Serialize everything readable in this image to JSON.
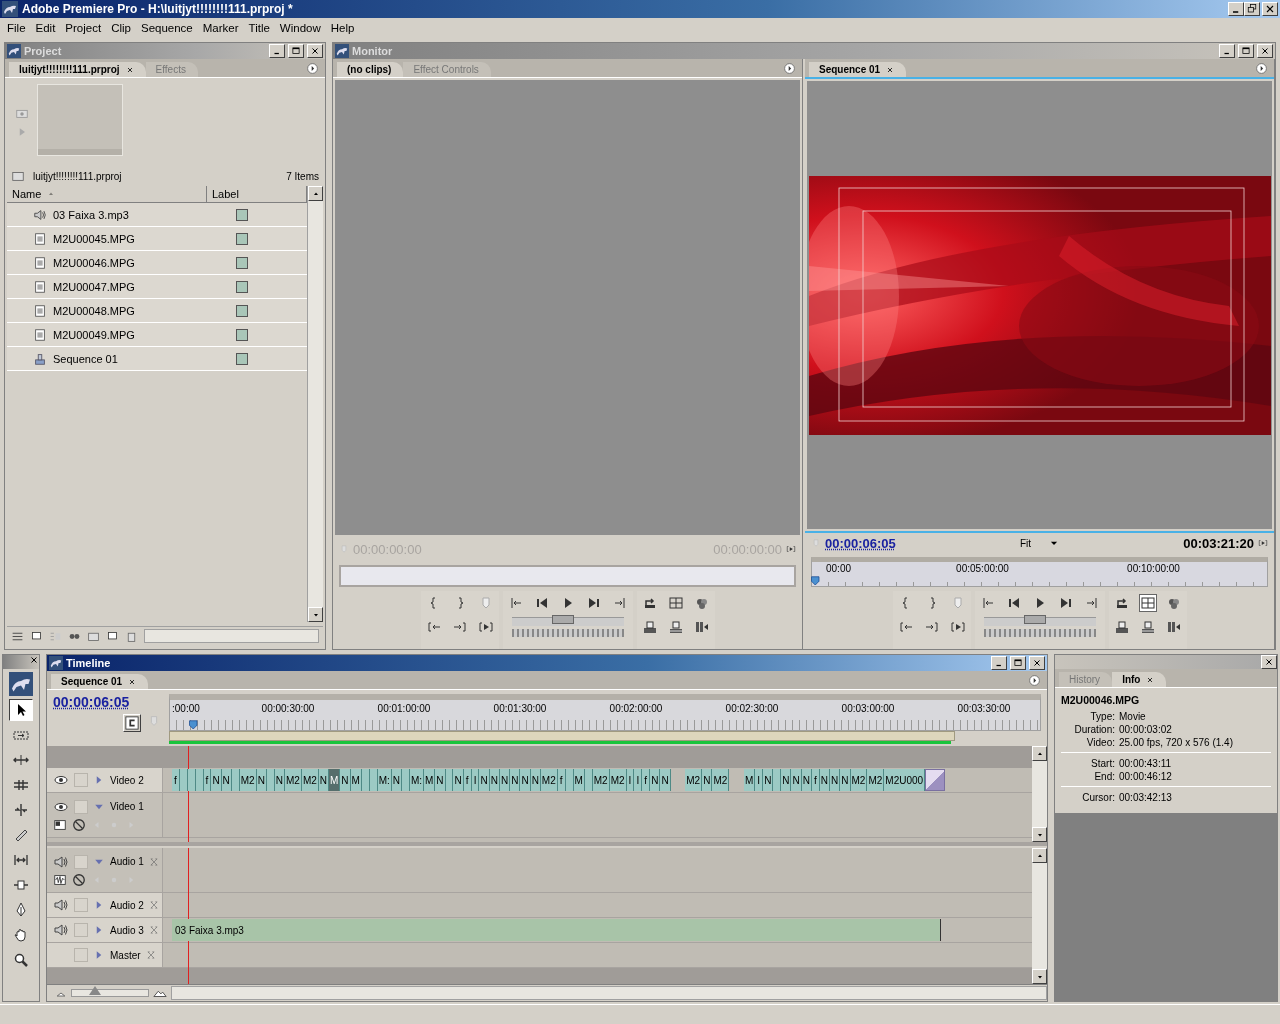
{
  "window": {
    "title": "Adobe Premiere Pro - H:\\luitjyt!!!!!!!!111.prproj *"
  },
  "menu": [
    "File",
    "Edit",
    "Project",
    "Clip",
    "Sequence",
    "Marker",
    "Title",
    "Window",
    "Help"
  ],
  "project": {
    "title": "Project",
    "tabs": [
      {
        "label": "luitjyt!!!!!!!!111.prproj",
        "selected": true,
        "closable": true
      },
      {
        "label": "Effects",
        "selected": false,
        "closable": false
      }
    ],
    "file_name": "luitjyt!!!!!!!!111.prproj",
    "item_count": "7 Items",
    "columns": [
      "Name",
      "Label"
    ],
    "items": [
      {
        "kind": "audio",
        "name": "03 Faixa 3.mp3",
        "color": "#a9c6b8"
      },
      {
        "kind": "video",
        "name": "M2U00045.MPG",
        "color": "#a9c6b8"
      },
      {
        "kind": "video",
        "name": "M2U00046.MPG",
        "color": "#a9c6b8"
      },
      {
        "kind": "video",
        "name": "M2U00047.MPG",
        "color": "#a9c6b8"
      },
      {
        "kind": "video",
        "name": "M2U00048.MPG",
        "color": "#a9c6b8"
      },
      {
        "kind": "video",
        "name": "M2U00049.MPG",
        "color": "#a9c6b8"
      },
      {
        "kind": "sequence",
        "name": "Sequence 01",
        "color": "#a9c6b8"
      }
    ]
  },
  "monitor": {
    "title": "Monitor",
    "source": {
      "tabs": [
        {
          "label": "(no clips)",
          "selected": true,
          "closable": false
        },
        {
          "label": "Effect Controls",
          "selected": false,
          "closable": false
        }
      ],
      "timecode": "00:00:00:00",
      "duration": "00:00:00:00",
      "shuttle": {
        "level": 0.45
      }
    },
    "program": {
      "tabs": [
        {
          "label": "Sequence 01",
          "selected": true,
          "closable": true
        }
      ],
      "timecode": "00:00:06:05",
      "zoom": "Fit",
      "duration": "00:03:21:20",
      "ruler": [
        "00:00",
        "00:05:00:00",
        "00:10:00:00"
      ],
      "shuttle": {
        "level": 0.45
      }
    }
  },
  "tools": [
    {
      "kind": "selection",
      "selected": true
    },
    {
      "kind": "track_select",
      "selected": false
    },
    {
      "kind": "ripple",
      "selected": false
    },
    {
      "kind": "rolling",
      "selected": false
    },
    {
      "kind": "rate",
      "selected": false
    },
    {
      "kind": "razor",
      "selected": false
    },
    {
      "kind": "slip",
      "selected": false
    },
    {
      "kind": "slide",
      "selected": false
    },
    {
      "kind": "pen",
      "selected": false
    },
    {
      "kind": "hand",
      "selected": false
    },
    {
      "kind": "zoom",
      "selected": false
    }
  ],
  "timeline": {
    "title": "Timeline",
    "tabs": [
      {
        "label": "Sequence 01",
        "selected": true,
        "closable": true
      }
    ],
    "timecode": "00:00:06:05",
    "ruler": [
      ":00:00",
      "00:00:30:00",
      "00:01:00:00",
      "00:01:30:00",
      "00:02:00:00",
      "00:02:30:00",
      "00:03:00:00",
      "00:03:30:00"
    ],
    "zoom": {
      "level": 0.3
    },
    "tracks": [
      {
        "kind": "video",
        "name": "Video 2",
        "expanded": false,
        "clips": [
          {
            "kind": "clip",
            "label": "f",
            "selected": false
          },
          {
            "kind": "clip",
            "selected": false
          },
          {
            "kind": "clip",
            "selected": false
          },
          {
            "kind": "clip",
            "selected": false
          },
          {
            "kind": "clip",
            "label": "f",
            "selected": false
          },
          {
            "kind": "clip",
            "label": "N",
            "selected": false
          },
          {
            "kind": "clip",
            "label": "N",
            "selected": false
          },
          {
            "kind": "clip",
            "selected": false
          },
          {
            "kind": "clip",
            "label": "M2",
            "selected": false
          },
          {
            "kind": "clip",
            "label": "N",
            "selected": false
          },
          {
            "kind": "clip",
            "selected": false
          },
          {
            "kind": "clip",
            "label": "N",
            "selected": false
          },
          {
            "kind": "clip",
            "label": "M2",
            "selected": false
          },
          {
            "kind": "clip",
            "label": "M2",
            "selected": false
          },
          {
            "kind": "clip",
            "label": "N",
            "selected": false
          },
          {
            "kind": "clip",
            "label": "M",
            "selected": true
          },
          {
            "kind": "clip",
            "label": "N",
            "selected": false
          },
          {
            "kind": "clip",
            "label": "M",
            "selected": false
          },
          {
            "kind": "clip",
            "selected": false
          },
          {
            "kind": "clip",
            "selected": false
          },
          {
            "kind": "clip",
            "label": "M:",
            "selected": false
          },
          {
            "kind": "clip",
            "label": "N",
            "selected": false
          },
          {
            "kind": "clip",
            "selected": false
          },
          {
            "kind": "clip",
            "label": "M:",
            "selected": false
          },
          {
            "kind": "clip",
            "label": "M",
            "selected": false
          },
          {
            "kind": "clip",
            "label": "N",
            "selected": false
          },
          {
            "kind": "clip",
            "selected": false
          },
          {
            "kind": "clip",
            "label": "N",
            "selected": false
          },
          {
            "kind": "clip",
            "label": "f",
            "selected": false
          },
          {
            "kind": "clip",
            "label": "I",
            "selected": false
          },
          {
            "kind": "clip",
            "label": "N",
            "selected": false
          },
          {
            "kind": "clip",
            "label": "N",
            "selected": false
          },
          {
            "kind": "clip",
            "label": "N",
            "selected": false
          },
          {
            "kind": "clip",
            "label": "N",
            "selected": false
          },
          {
            "kind": "clip",
            "label": "N",
            "selected": false
          },
          {
            "kind": "clip",
            "label": "N",
            "selected": false
          },
          {
            "kind": "clip",
            "label": "M2",
            "selected": false
          },
          {
            "kind": "clip",
            "label": "f",
            "selected": false
          },
          {
            "kind": "clip",
            "selected": false
          },
          {
            "kind": "clip",
            "label": "M",
            "selected": false
          },
          {
            "kind": "clip",
            "selected": false
          },
          {
            "kind": "clip",
            "label": "M2",
            "selected": false
          },
          {
            "kind": "clip",
            "label": "M2",
            "selected": false
          },
          {
            "kind": "clip",
            "label": "I",
            "selected": false
          },
          {
            "kind": "clip",
            "label": "I",
            "selected": false
          },
          {
            "kind": "clip",
            "label": "f",
            "selected": false
          },
          {
            "kind": "clip",
            "label": "N",
            "selected": false
          },
          {
            "kind": "clip",
            "label": "N",
            "selected": false
          },
          {
            "kind": "gap"
          },
          {
            "kind": "clip",
            "label": "M2",
            "selected": false
          },
          {
            "kind": "clip",
            "label": "N",
            "selected": false
          },
          {
            "kind": "clip",
            "label": "M2",
            "selected": false
          },
          {
            "kind": "gap"
          },
          {
            "kind": "clip",
            "label": "M",
            "selected": false
          },
          {
            "kind": "clip",
            "label": "I",
            "selected": false
          },
          {
            "kind": "clip",
            "label": "N",
            "selected": false
          },
          {
            "kind": "clip",
            "selected": false
          },
          {
            "kind": "clip",
            "label": "N",
            "selected": false
          },
          {
            "kind": "clip",
            "label": "N",
            "selected": false
          },
          {
            "kind": "clip",
            "label": "N",
            "selected": false
          },
          {
            "kind": "clip",
            "label": "f",
            "selected": false
          },
          {
            "kind": "clip",
            "label": "N",
            "selected": false
          },
          {
            "kind": "clip",
            "label": "N",
            "selected": false
          },
          {
            "kind": "clip",
            "label": "N",
            "selected": false
          },
          {
            "kind": "clip",
            "label": "M2",
            "selected": false
          },
          {
            "kind": "clip",
            "label": "M2",
            "selected": false
          },
          {
            "kind": "clip",
            "label": "M2U000",
            "selected": false
          },
          {
            "kind": "transition"
          }
        ]
      },
      {
        "kind": "video",
        "name": "Video 1",
        "expanded": true
      },
      {
        "kind": "audio",
        "name": "Audio 1",
        "expanded": true
      },
      {
        "kind": "audio",
        "name": "Audio 2",
        "expanded": false
      },
      {
        "kind": "audio",
        "name": "Audio 3",
        "expanded": false,
        "clips": [
          {
            "kind": "audio_clip",
            "label": "03 Faixa 3.mp3",
            "selected": false
          }
        ]
      },
      {
        "kind": "master",
        "name": "Master",
        "expanded": false
      }
    ]
  },
  "info": {
    "tabs": [
      {
        "label": "History",
        "selected": false,
        "closable": false
      },
      {
        "label": "Info",
        "selected": true,
        "closable": true
      }
    ],
    "clip_name": "M2U00046.MPG",
    "sections": [
      [
        {
          "label": "Type:",
          "value": "Movie"
        },
        {
          "label": "Duration:",
          "value": "00:00:03:02"
        },
        {
          "label": "Video:",
          "value": "25.00 fps, 720 x 576 (1.4)"
        }
      ],
      [
        {
          "label": "Start:",
          "value": "00:00:43:11"
        },
        {
          "label": "End:",
          "value": "00:00:46:12"
        }
      ],
      [
        {
          "label": "Cursor:",
          "value": "00:03:42:13"
        }
      ]
    ]
  }
}
